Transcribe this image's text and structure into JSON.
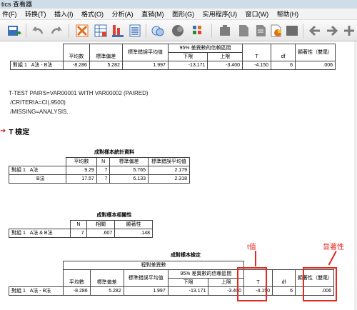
{
  "window": {
    "title": "tics 查看器"
  },
  "menu": {
    "items": [
      "件(F)",
      "转换(T)",
      "插入(I)",
      "格式(O)",
      "分析(A)",
      "直销(M)",
      "图形(G)",
      "实用程序(U)",
      "窗口(W)",
      "帮助(H)"
    ]
  },
  "toolbar": {
    "icons": [
      "export-icon",
      "undo-icon",
      "redo-icon",
      "goto-data-icon",
      "goto-case-icon",
      "goto-variable-icon",
      "variables-icon",
      "circles-icon",
      "split-icon",
      "select-cases-icon",
      "insert-output-icon",
      "insert-heading-icon",
      "insert-text-icon",
      "insert-chart-icon",
      "designate-window-icon",
      "back-arrow-icon",
      "forward-arrow-icon",
      "add-icon"
    ]
  },
  "table_top": {
    "col_mean": "平均数",
    "col_sd": "標準偏差",
    "col_se": "標準錯誤平均值",
    "col_ci": "95% 差異數的信賴區間",
    "col_lower": "下限",
    "col_upper": "上限",
    "col_t": "T",
    "col_df": "df",
    "col_sig": "顯著性（雙尾）",
    "row_group": "對組 1",
    "row_label": "A法 - B法",
    "mean": "-8.286",
    "sd": "5.282",
    "se": "1.997",
    "lower": "-13.171",
    "upper": "-3.400",
    "t": "-4.150",
    "df": "6",
    "sig": ".006"
  },
  "syntax": "T-TEST PAIRS=VAR00001 WITH VAR00002 (PAIRED)\n /CRITERIA=CI(.9500)\n /MISSING=ANALYSIS.",
  "heading": "T 檢定",
  "stats": {
    "caption": "成對樣本統計資料",
    "col_mean": "平均數",
    "col_n": "N",
    "col_sd": "標準偏差",
    "col_se": "標準錯誤平均值",
    "group": "對組 1",
    "rows": [
      {
        "label": "A法",
        "mean": "9.29",
        "n": "7",
        "sd": "5.765",
        "se": "2.179"
      },
      {
        "label": "B法",
        "mean": "17.57",
        "n": "7",
        "sd": "6.133",
        "se": "2.318"
      }
    ]
  },
  "corr": {
    "caption": "成對樣本相關性",
    "col_n": "N",
    "col_r": "相關",
    "col_sig": "顯著性",
    "group": "對組 1",
    "label": "A法 & B法",
    "n": "7",
    "r": ".607",
    "sig": ".148"
  },
  "test": {
    "caption": "成對樣本檢定",
    "col_pair": "程對差異數",
    "col_mean": "平均數",
    "col_sd": "標準偏差",
    "col_se": "標準錯誤平均值",
    "col_ci": "95% 差異數的信賴區間",
    "col_lower": "下限",
    "col_upper": "上限",
    "col_t": "T",
    "col_df": "df",
    "col_sig": "顯著性（雙尾）",
    "group": "對組 1",
    "label": "A法 - B法",
    "mean": "-8.286",
    "sd": "5.282",
    "se": "1.997",
    "lower": "-13.171",
    "upper": "-3.400",
    "t": "-4.150",
    "df": "6",
    "sig": ".006"
  },
  "annotations": {
    "t_label": "t值",
    "sig_label": "显著性",
    "color": "#e8271f"
  }
}
